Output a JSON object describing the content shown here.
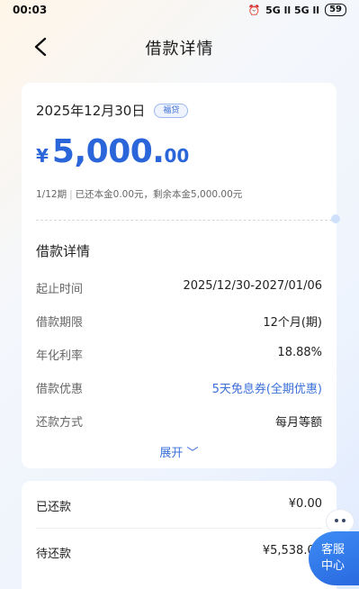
{
  "status_bar": {
    "time": "00:03",
    "signal": "5G ll 5G ll",
    "battery": "59"
  },
  "header": {
    "title": "借款详情"
  },
  "loan": {
    "date": "2025年12月30日",
    "tag": "福贷",
    "amount_currency": "¥",
    "amount_int": "5,000.",
    "amount_dec": "00",
    "period_text": "1/12期",
    "progress_text": "已还本金0.00元，剩余本金5,000.00元"
  },
  "details": {
    "title": "借款详情",
    "rows": [
      {
        "label": "起止时间",
        "value": "2025/12/30-2027/01/06"
      },
      {
        "label": "借款期限",
        "value": "12个月(期)"
      },
      {
        "label": "年化利率",
        "value": "18.88%"
      },
      {
        "label": "借款优惠",
        "value": "5天免息券(全期优惠)"
      },
      {
        "label": "还款方式",
        "value": "每月等额"
      }
    ],
    "expand_label": "展开 ﹀"
  },
  "repayment": {
    "paid_label": "已还款",
    "paid_value": "¥0.00",
    "pending_label": "待还款",
    "pending_value": "¥5,538.03"
  },
  "service": {
    "line1": "客服",
    "line2": "中心"
  },
  "colors": {
    "accent": "#2a66d9",
    "link": "#3a6fd8"
  }
}
